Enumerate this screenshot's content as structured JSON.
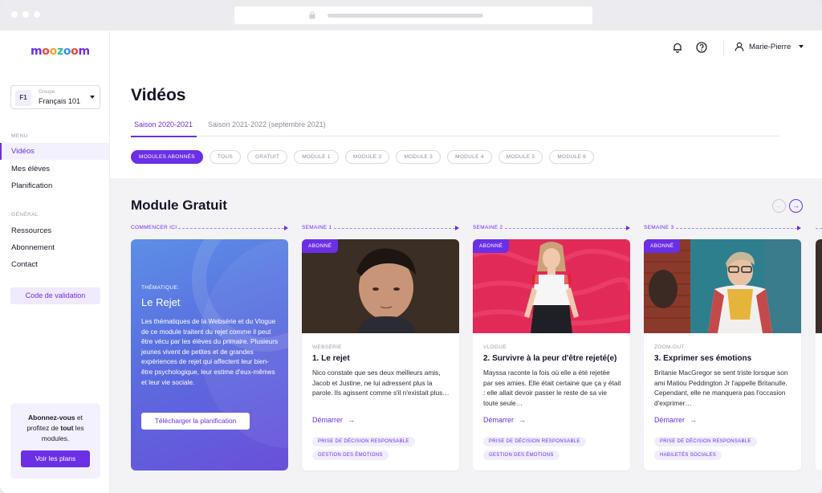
{
  "colors": {
    "accent": "#6b2fe6",
    "accent_light": "#f4f1ff",
    "text": "#1b1b2a",
    "muted": "#8b8b9c"
  },
  "brand": {
    "logo_letters": [
      "m",
      "o",
      "o",
      "z",
      "o",
      "o",
      "m"
    ]
  },
  "sidebar": {
    "group": {
      "badge": "F1",
      "label": "Groupe",
      "name": "Français 101"
    },
    "menu_label": "MENU",
    "menu": [
      {
        "label": "Vidéos",
        "active": true
      },
      {
        "label": "Mes élèves"
      },
      {
        "label": "Planification"
      }
    ],
    "general_label": "GÉNÉRAL",
    "general": [
      {
        "label": "Ressources"
      },
      {
        "label": "Abonnement"
      },
      {
        "label": "Contact"
      }
    ],
    "code_button": "Code de validation",
    "promo": {
      "text_a": "Abonnez-vous",
      "text_b": " et profitez de ",
      "text_c": "tout",
      "text_d": " les modules.",
      "button": "Voir les plans"
    }
  },
  "topbar": {
    "user": "Marie-Pierre",
    "icons": [
      "bell-icon",
      "help-icon",
      "user-icon"
    ]
  },
  "page": {
    "title": "Vidéos",
    "tabs": [
      {
        "label": "Saison 2020-2021",
        "active": true
      },
      {
        "label": "Saison 2021-2022 (septembre 2021)"
      }
    ],
    "chips": [
      "MODULES ABONNÉS",
      "TOUS",
      "GRATUIT",
      "MODULE 1",
      "MODULE 2",
      "MODULE 3",
      "MODULE 4",
      "MODULE 5",
      "MODULE 6"
    ]
  },
  "module": {
    "title": "Module Gratuit",
    "weeks": [
      "COMMENCER ICI",
      "SEMAINE 1",
      "SEMAINE 2",
      "SEMAINE 3"
    ],
    "theme": {
      "label": "THÉMATIQUE:",
      "title": "Le Rejet",
      "description": "Les thématiques de la Websérie et du Vlogue de ce module traitent du rejet comme il peut être vécu par les élèves du primaire. Plusieurs jeunes vivent de petites et de grandes expériences de rejet qui affectent leur bien-être psychologique, leur estime d'eux-mêmes et leur vie sociale.",
      "button": "Télécharger la planification"
    },
    "videos": [
      {
        "badge": "ABONNÉ",
        "category": "WEBSÉRIE",
        "title": "1. Le rejet",
        "description": "Nico constate que ses deux meilleurs amis, Jacob et Justine, ne lui adressent plus la parole. Ils agissent comme s'il n'existait plus…",
        "link": "Démarrer",
        "tags": [
          "PRISE DE DÉCISION RESPONSABLE",
          "GESTION DES ÉMOTIONS"
        ]
      },
      {
        "badge": "ABONNÉ",
        "category": "VLOGUE",
        "title": "2. Survivre à la peur d'être rejeté(e)",
        "description": "Mayssa raconte la fois où elle a été rejetée par ses amies. Elle était certaine que ça y était : elle allait devoir passer le reste de sa vie toute seule…",
        "link": "Démarrer",
        "tags": [
          "PRISE DE DÉCISION RESPONSABLE",
          "GESTION DES ÉMOTIONS"
        ]
      },
      {
        "badge": "ABONNÉ",
        "category": "ZOOM-OUT",
        "title": "3. Exprimer ses émotions",
        "description": "Britanie MacGregor se sent triste lorsque son ami Matiou Peddington Jr l'appelle Britanulle. Cependant, elle ne manquera pas l'occasion d'exprimer…",
        "link": "Démarrer",
        "tags": [
          "PRISE DE DÉCISION RESPONSABLE",
          "HABILETÉS SOCIALES"
        ]
      }
    ]
  }
}
